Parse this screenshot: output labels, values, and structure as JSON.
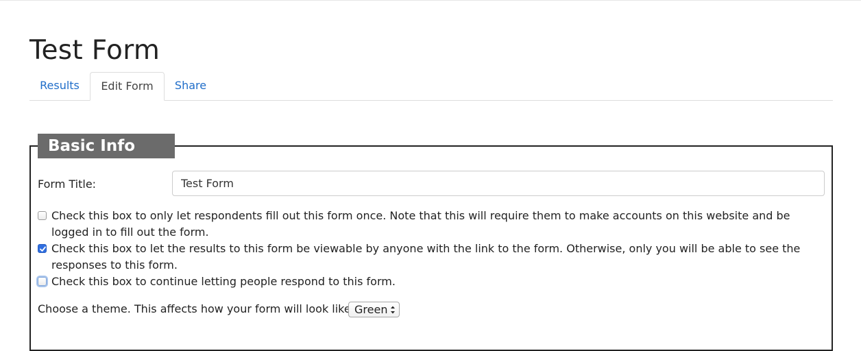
{
  "page": {
    "title": "Test Form"
  },
  "tabs": [
    {
      "label": "Results",
      "active": false
    },
    {
      "label": "Edit Form",
      "active": true
    },
    {
      "label": "Share",
      "active": false
    }
  ],
  "basic_info": {
    "legend": "Basic Info",
    "form_title_label": "Form Title:",
    "form_title_value": "Test Form",
    "options": [
      {
        "text": "Check this box to only let respondents fill out this form once. Note that this will require them to make accounts on this website and be logged in to fill out the form.",
        "checked": false
      },
      {
        "text": "Check this box to let the results to this form be viewable by anyone with the link to the form. Otherwise, only you will be able to see the responses to this form.",
        "checked": true
      },
      {
        "text": "Check this box to continue letting people respond to this form.",
        "checked": false
      }
    ],
    "theme_label": "Choose a theme. This affects how your form will look like.",
    "theme_selected": "Green"
  },
  "colors": {
    "link": "#1f6dc9",
    "legend_bg": "#6b6b6b",
    "checkbox_checked": "#2f6ee0"
  }
}
